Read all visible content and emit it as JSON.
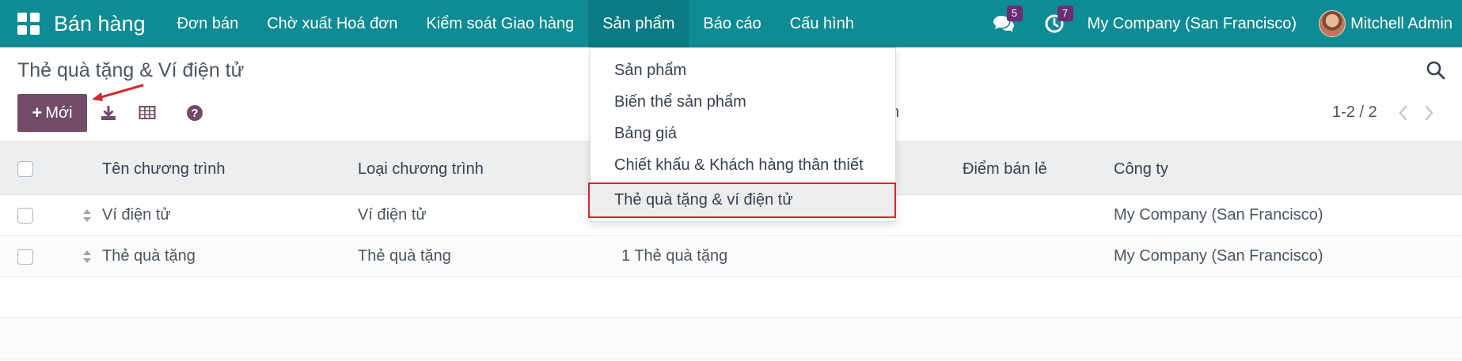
{
  "navbar": {
    "brand": "Bán hàng",
    "menu": [
      {
        "label": "Đơn bán"
      },
      {
        "label": "Chờ xuất Hoá đơn"
      },
      {
        "label": "Kiểm soát Giao hàng"
      },
      {
        "label": "Sản phẩm"
      },
      {
        "label": "Báo cáo"
      },
      {
        "label": "Cấu hình"
      }
    ],
    "messages_count": "5",
    "activities_count": "7",
    "company": "My Company (San Francisco)",
    "user": "Mitchell Admin",
    "accent_color": "#0f8b94"
  },
  "control_panel": {
    "title": "Thẻ quà tặng & Ví điện tử",
    "new_button": "Mới",
    "plus": "+",
    "pager": "1-2 / 2",
    "hidden_fragment": "n",
    "button_color": "#714b67"
  },
  "table": {
    "headers": [
      "Tên chương trình",
      "Loại chương trình",
      "Điểm bán lẻ",
      "Công ty"
    ],
    "rows": [
      {
        "name": "Ví điện tử",
        "type": "Ví điện tử",
        "items": "",
        "company": "My Company (San Francisco)"
      },
      {
        "name": "Thẻ quà tặng",
        "type": "Thẻ quà tặng",
        "items": "1 Thẻ quà tặng",
        "company": "My Company (San Francisco)"
      }
    ]
  },
  "dropdown": {
    "items": [
      {
        "label": "Sản phẩm"
      },
      {
        "label": "Biến thể sản phẩm"
      },
      {
        "label": "Bảng giá"
      },
      {
        "label": "Chiết khấu & Khách hàng thân thiết"
      },
      {
        "label": "Thẻ quà tặng & ví điện tử"
      }
    ],
    "highlight_color": "#d7262b"
  },
  "icons": {
    "apps": "apps-grid-icon",
    "messages": "chat-bubbles-icon",
    "activities": "clock-icon",
    "search": "search-icon",
    "download": "download-icon",
    "spreadsheet": "spreadsheet-icon",
    "help": "help-icon"
  }
}
